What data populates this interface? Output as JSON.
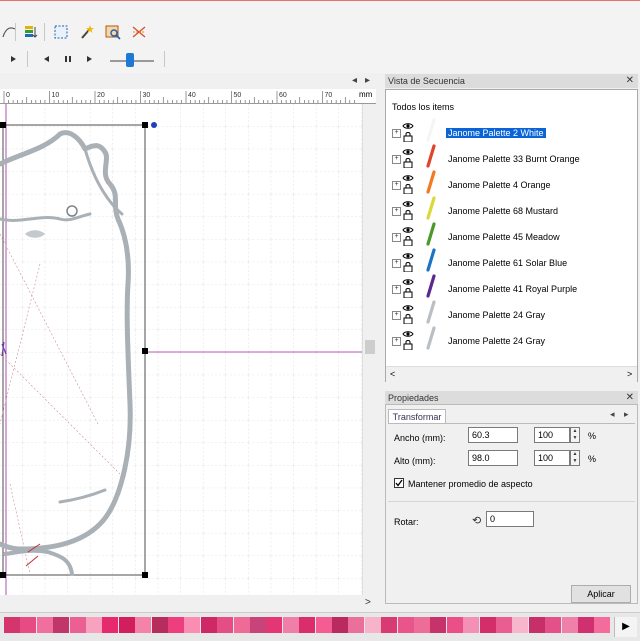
{
  "toolbar": {
    "icons": [
      "curve-tool-icon",
      "color-sort-icon",
      "select-box-icon",
      "magic-wand-icon",
      "trace-image-icon",
      "stitch-effects-icon"
    ],
    "playback": [
      "next-icon",
      "previous-icon",
      "pause-icon",
      "play-icon"
    ],
    "speed_slider_level": 0.35
  },
  "canvas": {
    "ruler_ticks": [
      "0",
      "10",
      "20",
      "30",
      "40",
      "50",
      "60",
      "70"
    ],
    "ruler_unit": "mm",
    "nav_left": "◂",
    "nav_right": "▸"
  },
  "sequence_view": {
    "title": "Vista de Secuencia",
    "root_label": "Todos los items",
    "items": [
      {
        "label": "Janome Palette 2 White",
        "color": "#f5f5f5",
        "selected": true
      },
      {
        "label": "Janome Palette 33 Burnt Orange",
        "color": "#e0452b",
        "selected": false
      },
      {
        "label": "Janome Palette 4 Orange",
        "color": "#f47a20",
        "selected": false
      },
      {
        "label": "Janome Palette 68 Mustard",
        "color": "#d9d93a",
        "selected": false
      },
      {
        "label": "Janome Palette 45 Meadow",
        "color": "#4a9a2a",
        "selected": false
      },
      {
        "label": "Janome Palette 61 Solar Blue",
        "color": "#1c74c4",
        "selected": false
      },
      {
        "label": "Janome Palette 41 Royal Purple",
        "color": "#5b2a8e",
        "selected": false
      },
      {
        "label": "Janome Palette 24 Gray",
        "color": "#b9bfc4",
        "selected": false
      },
      {
        "label": "Janome Palette 24 Gray",
        "color": "#b9bfc4",
        "selected": false
      }
    ]
  },
  "properties": {
    "title": "Propiedades",
    "tab": "Transformar",
    "width_label": "Ancho (mm):",
    "width_value": "60.3",
    "width_percent": "100",
    "height_label": "Alto (mm):",
    "height_value": "98.0",
    "height_percent": "100",
    "percent_sign": "%",
    "keep_aspect_label": "Mantener promedio de aspecto",
    "keep_aspect_checked": true,
    "rotate_label": "Rotar:",
    "rotate_value": "0",
    "apply_label": "Aplicar"
  },
  "color_bar": {
    "colors": [
      "#d5356d",
      "#e74b83",
      "#f06f9c",
      "#c1356a",
      "#ec5f92",
      "#f7a3c0",
      "#e62a6e",
      "#d11e5c",
      "#f582a8",
      "#b62d5d",
      "#ed3f7d",
      "#fa8eb2",
      "#cf2866",
      "#e54d85",
      "#f06a98",
      "#c7437a",
      "#e33673",
      "#ef7fa6",
      "#da2e6c",
      "#f45d91",
      "#b92a60",
      "#ea6f9b",
      "#f7b3c9",
      "#d83b74",
      "#e8558a",
      "#ee6c98",
      "#c7326b",
      "#ea4f86",
      "#f590b5",
      "#d42e69",
      "#e95d90",
      "#f8b6cd",
      "#c72f69",
      "#e3508a",
      "#ef81a8",
      "#d03070",
      "#f46c9b"
    ],
    "nav_right": "▶"
  },
  "scroll": {
    "up": "▲",
    "down": "▼",
    "left": "<",
    "right": ">",
    "hright": ">"
  }
}
